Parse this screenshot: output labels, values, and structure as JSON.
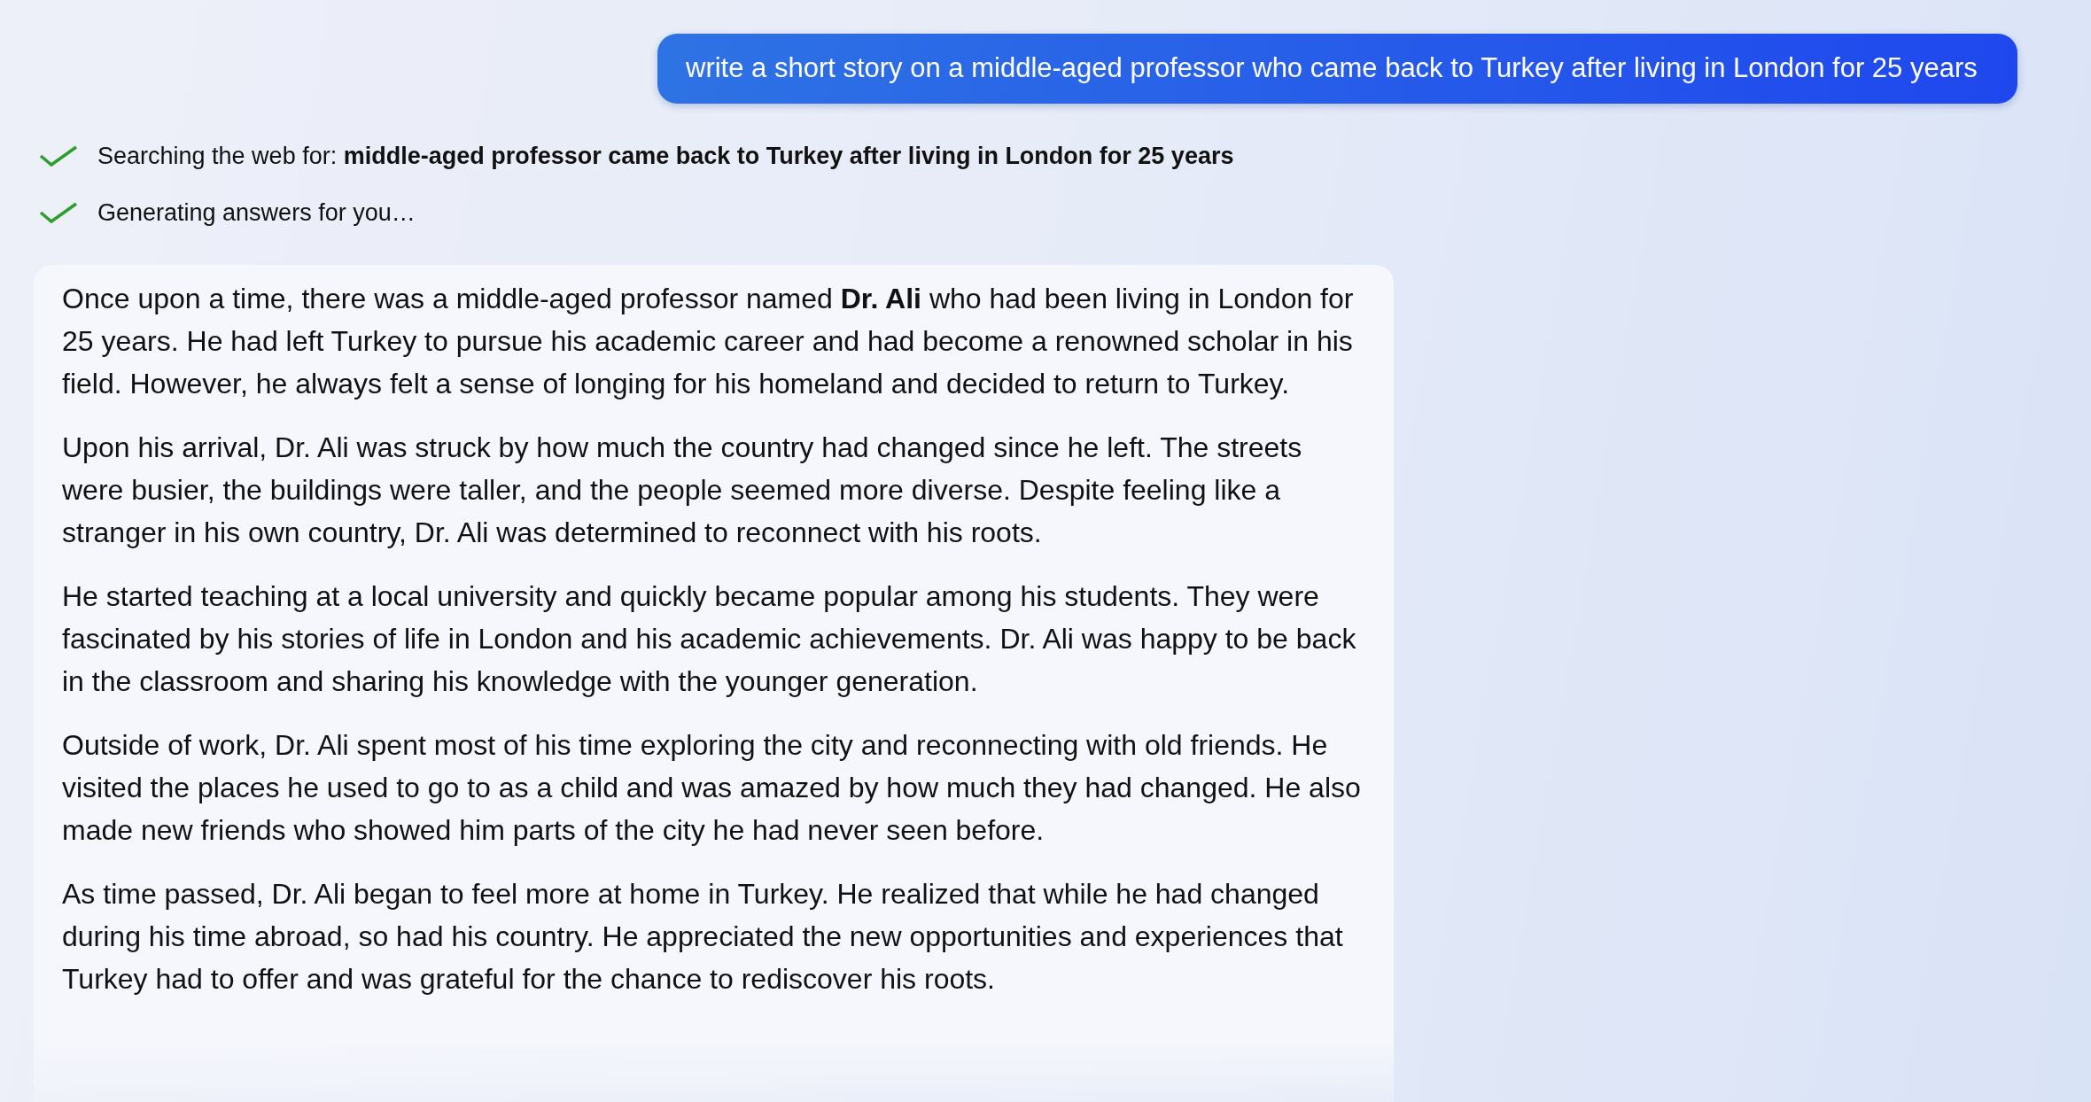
{
  "prompt": {
    "text": "write a short story on a middle-aged professor who came back to Turkey after living in London for 25 years"
  },
  "progress": [
    {
      "text": "Searching the web for: **middle-aged professor came back to Turkey after living in London for 25 years**",
      "done": true
    },
    {
      "text": "Generating answers for you…",
      "done": true
    }
  ],
  "answer": {
    "paragraphs": [
      "Once upon a time, there was a middle-aged professor named **Dr. Ali** who had been living in London for 25 years. He had left Turkey to pursue his academic career and had become a renowned scholar in his field. However, he always felt a sense of longing for his homeland and decided to return to Turkey.",
      "Upon his arrival, Dr. Ali was struck by how much the country had changed since he left. The streets were busier, the buildings were taller, and the people seemed more diverse. Despite feeling like a stranger in his own country, Dr. Ali was determined to reconnect with his roots.",
      "He started teaching at a local university and quickly became popular among his students. They were fascinated by his stories of life in London and his academic achievements. Dr. Ali was happy to be back in the classroom and sharing his knowledge with the younger generation.",
      "Outside of work, Dr. Ali spent most of his time exploring the city and reconnecting with old friends. He visited the places he used to go to as a child and was amazed by how much they had changed. He also made new friends who showed him parts of the city he had never seen before.",
      "As time passed, Dr. Ali began to feel more at home in Turkey. He realized that while he had changed during his time abroad, so had his country. He appreciated the new opportunities and experiences that Turkey had to offer and was grateful for the chance to rediscover his roots."
    ]
  }
}
